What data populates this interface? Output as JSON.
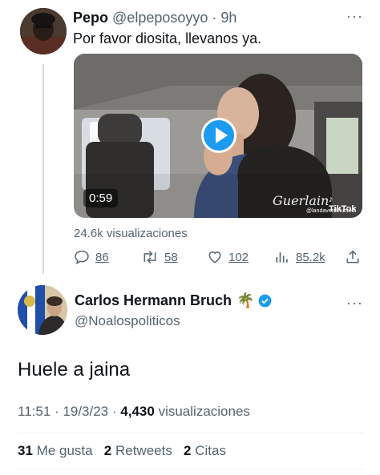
{
  "reply": {
    "name": "Pepo",
    "handle": "@elpeposoyyo",
    "dot": "·",
    "time": "9h",
    "more": "···",
    "text": "Por favor diosita, llevanos ya.",
    "video": {
      "duration": "0:59",
      "watermark_brand": "Guerlain",
      "watermark_app": "TikTok",
      "watermark_user": "@landaverdelucreci"
    },
    "views": "24.6k visualizaciones",
    "actions": {
      "replies": "86",
      "retweets": "58",
      "likes": "102",
      "views": "85.2k"
    }
  },
  "main": {
    "name": "Carlos Hermann Bruch",
    "name_emoji": "🌴",
    "handle": "@Noalospoliticos",
    "more": "···",
    "text": "Huele a jaina",
    "meta": {
      "time": "11:51",
      "sep1": "·",
      "date": "19/3/23",
      "sep2": "·",
      "views_count": "4,430",
      "views_label": "visualizaciones"
    },
    "stats": {
      "likes_count": "31",
      "likes_label": "Me gusta",
      "retweets_count": "2",
      "retweets_label": "Retweets",
      "quotes_count": "2",
      "quotes_label": "Citas"
    }
  },
  "colors": {
    "accent": "#1d9bf0",
    "secondary_text": "#536471",
    "primary_text": "#0f1419",
    "verified": "#1d9bf0"
  },
  "icons": [
    "reply-icon",
    "retweet-icon",
    "like-icon",
    "analytics-icon",
    "share-icon",
    "verified-badge-icon",
    "play-icon"
  ]
}
